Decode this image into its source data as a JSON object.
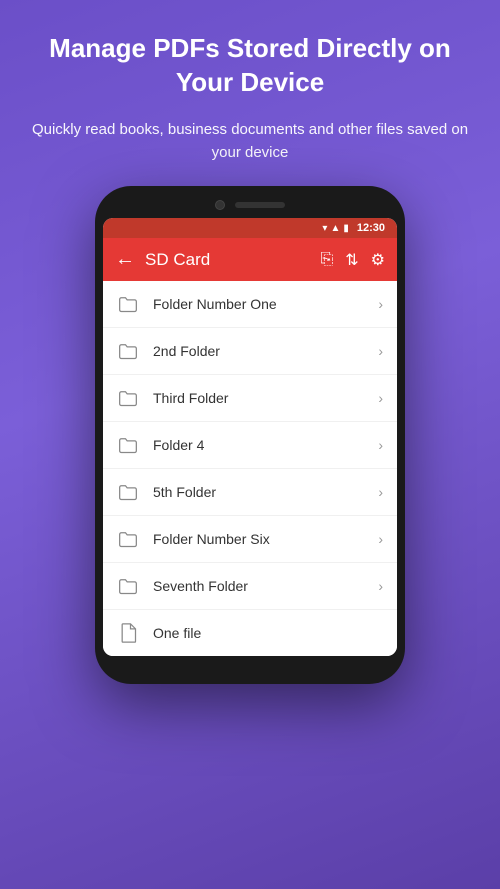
{
  "hero": {
    "title": "Manage PDFs Stored Directly on Your Device",
    "subtitle": "Quickly read books, business documents and other files saved on your device"
  },
  "status_bar": {
    "time": "12:30"
  },
  "toolbar": {
    "title": "SD Card",
    "back_label": "←"
  },
  "files": [
    {
      "id": 1,
      "name": "Folder Number One",
      "type": "folder"
    },
    {
      "id": 2,
      "name": "2nd Folder",
      "type": "folder"
    },
    {
      "id": 3,
      "name": "Third Folder",
      "type": "folder"
    },
    {
      "id": 4,
      "name": "Folder 4",
      "type": "folder"
    },
    {
      "id": 5,
      "name": "5th Folder",
      "type": "folder"
    },
    {
      "id": 6,
      "name": "Folder Number Six",
      "type": "folder"
    },
    {
      "id": 7,
      "name": "Seventh Folder",
      "type": "folder"
    },
    {
      "id": 8,
      "name": "One file",
      "type": "file"
    }
  ],
  "colors": {
    "toolbar": "#e53935",
    "background_start": "#6b4fc8",
    "background_end": "#5b3fa8"
  }
}
